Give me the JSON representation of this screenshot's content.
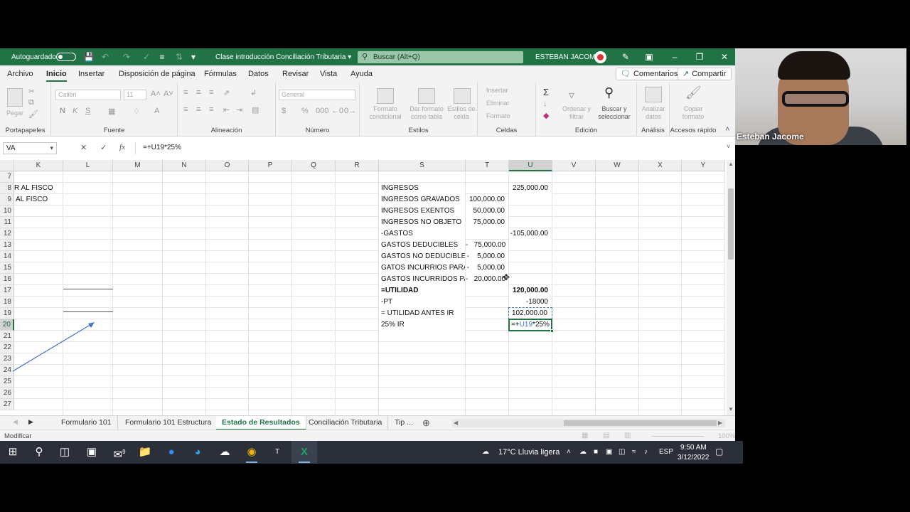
{
  "titlebar": {
    "autosave_label": "Autoguardado",
    "doc_title": "Clase introducción Conciliación Tributaria ▾",
    "search_placeholder": "Buscar (Alt+Q)",
    "user": "ESTEBAN JACOME"
  },
  "menu": {
    "items": [
      "Archivo",
      "Inicio",
      "Insertar",
      "Disposición de página",
      "Fórmulas",
      "Datos",
      "Revisar",
      "Vista",
      "Ayuda"
    ],
    "comments": "Comentarios",
    "share": "Compartir"
  },
  "ribbon": {
    "paste": "Pegar",
    "font_name": "Calibri",
    "font_size": "11",
    "number_format": "General",
    "cond_format": "Formato\ncondicional",
    "format_table": "Dar formato\ncomo tabla",
    "cell_styles": "Estilos de\ncelda",
    "insert": "Insertar",
    "delete": "Eliminar",
    "format": "Formato",
    "sort_filter": "Ordenar y\nfiltrar",
    "find_select": "Buscar y\nseleccionar",
    "analyze": "Analizar\ndatos",
    "copy_format": "Copiar\nformato",
    "groups": [
      "Portapapeles",
      "Fuente",
      "Alineación",
      "Número",
      "Estilos",
      "Celdas",
      "Edición",
      "Análisis",
      "Accesos rápido"
    ]
  },
  "formula_bar": {
    "name_box": "VA",
    "fx": "fx",
    "formula": "=+U19*25%"
  },
  "sheet": {
    "columns": [
      "K",
      "L",
      "M",
      "N",
      "O",
      "P",
      "Q",
      "R",
      "S",
      "T",
      "U",
      "V",
      "W",
      "X",
      "Y"
    ],
    "rows": [
      "7",
      "8",
      "9",
      "10",
      "11",
      "12",
      "13",
      "14",
      "15",
      "16",
      "17",
      "18",
      "19",
      "20",
      "21",
      "22",
      "23",
      "24",
      "25",
      "26",
      "27"
    ],
    "k8": "R AL FISCO",
    "k9": "AL FISCO",
    "s": {
      "r8": "INGRESOS",
      "r9": "INGRESOS GRAVADOS",
      "r10": "INGRESOS EXENTOS",
      "r11": "INGRESOS NO OBJETO",
      "r12": "-GASTOS",
      "r13": "GASTOS DEDUCIBLES",
      "r14": "GASTOS NO DEDUCIBLES",
      "r15": "GATOS INCURRIOS PARA G",
      "r16": "GASTOS INCURRIDOS PAR",
      "r17": "=UTILIDAD",
      "r18": "-PT",
      "r19": "= UTILIDAD ANTES IR",
      "r20": "25% IR"
    },
    "t": {
      "r9": "100,000.00",
      "r10": "50,000.00",
      "r11": "75,000.00",
      "r13": "-   75,000.00",
      "r14": "-    5,000.00",
      "r15": "-    5,000.00",
      "r16": "-   20,000.00"
    },
    "u": {
      "r8": "225,000.00",
      "r12": "-105,000.00",
      "r17": "120,000.00",
      "r18": "-18000",
      "r19": "102,000.00"
    },
    "edit_prefix": "=+",
    "edit_ref": "U19",
    "edit_suffix": "*25%"
  },
  "tabs": [
    "Formulario 101",
    "Formulario 101 Estructura",
    "Estado de Resultados",
    "Conciliación Tributaria",
    "Tip ..."
  ],
  "status": {
    "mode": "Modificar",
    "zoom": "100%"
  },
  "taskbar": {
    "weather": "17°C  Lluvia ligera",
    "lang": "ESP",
    "time": "9:50 AM",
    "date": "3/12/2022",
    "mail_badge": "9"
  },
  "webcam": {
    "name": "Esteban Jacome"
  },
  "colors": {
    "excel_green": "#217346",
    "taskbar": "#2b2f3a"
  }
}
